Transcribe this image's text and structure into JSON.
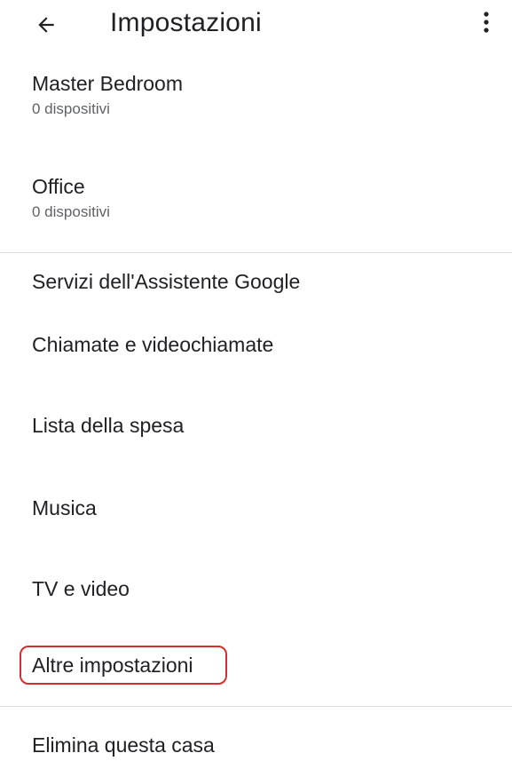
{
  "header": {
    "title": "Impostazioni",
    "back_icon": "arrow-left-icon",
    "menu_icon": "more-vert-icon"
  },
  "rooms": [
    {
      "name": "Master Bedroom",
      "count": "0 dispositivi"
    },
    {
      "name": "Office",
      "count": "0 dispositivi"
    }
  ],
  "assistant_section": {
    "title": "Servizi dell'Assistente Google",
    "items": [
      {
        "label": "Chiamate e videochiamate"
      },
      {
        "label": "Lista della spesa"
      },
      {
        "label": "Musica"
      },
      {
        "label": "TV e video"
      },
      {
        "label": "Altre impostazioni"
      }
    ]
  },
  "footer_action": {
    "label": "Elimina questa casa"
  },
  "colors": {
    "text_primary": "#202124",
    "text_secondary": "#5f6368",
    "divider": "#dadce0",
    "highlight": "#d32f2f"
  }
}
